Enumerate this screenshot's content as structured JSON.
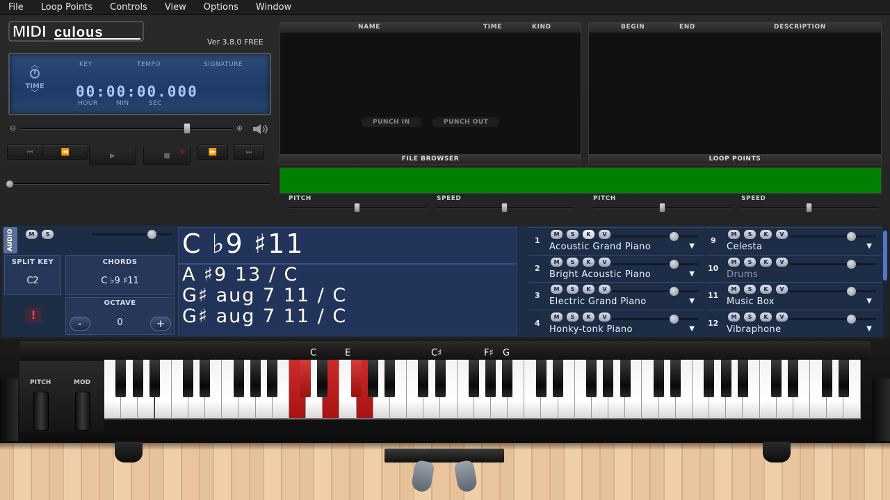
{
  "menu": [
    "File",
    "Loop Points",
    "Controls",
    "View",
    "Options",
    "Window"
  ],
  "app": {
    "logo_text": "MIDIculous",
    "version": "Ver 3.8.0 FREE"
  },
  "display": {
    "mode_label": "TIME",
    "key_label": "KEY",
    "tempo_label": "TEMPO",
    "signature_label": "SIGNATURE",
    "time_value": "00:00:00.000",
    "hour_label": "HOUR",
    "min_label": "MIN",
    "sec_label": "SEC"
  },
  "file_browser": {
    "columns": [
      "NAME",
      "TIME",
      "KIND"
    ],
    "punch_in": "PUNCH IN",
    "punch_out": "PUNCH OUT",
    "footer": "FILE BROWSER"
  },
  "loop_points": {
    "columns": [
      "BEGIN",
      "END",
      "DESCRIPTION"
    ],
    "footer": "LOOP POINTS"
  },
  "sliders": {
    "pitch1": "PITCH",
    "speed1": "SPEED",
    "pitch2": "PITCH",
    "speed2": "SPEED"
  },
  "controls": {
    "audio_tab": "AUDIO",
    "m": "M",
    "s": "S",
    "k": "K",
    "v": "V",
    "split_key_label": "SPLIT KEY",
    "split_key_value": "C2",
    "chords_label": "CHORDS",
    "chords_value": "C ♭9 ♯11",
    "octave_label": "OCTAVE",
    "octave_value": "0",
    "minus": "-",
    "plus": "+",
    "warning": "!"
  },
  "chord_display": {
    "main": "C ♭9 ♯11",
    "lines": [
      "A ♯9 13 / C",
      "G♯ aug 7 11 / C",
      "G♯ aug 7 11 / C"
    ]
  },
  "tracks": [
    {
      "num": "1",
      "name": "Acoustic Grand Piano",
      "dim": false
    },
    {
      "num": "2",
      "name": "Bright Acoustic Piano",
      "dim": false
    },
    {
      "num": "3",
      "name": "Electric Grand Piano",
      "dim": false
    },
    {
      "num": "4",
      "name": "Honky-tonk Piano",
      "dim": false
    },
    {
      "num": "9",
      "name": "Celesta",
      "dim": false
    },
    {
      "num": "10",
      "name": "Drums",
      "dim": true
    },
    {
      "num": "11",
      "name": "Music Box",
      "dim": false
    },
    {
      "num": "12",
      "name": "Vibraphone",
      "dim": false
    }
  ],
  "keyboard": {
    "pitch_label": "PITCH",
    "mod_label": "MOD",
    "note_labels": [
      "C",
      "E",
      "C♯",
      "F♯",
      "G"
    ],
    "active_keys": [
      "C",
      "E",
      "C♯",
      "F♯",
      "G"
    ]
  }
}
